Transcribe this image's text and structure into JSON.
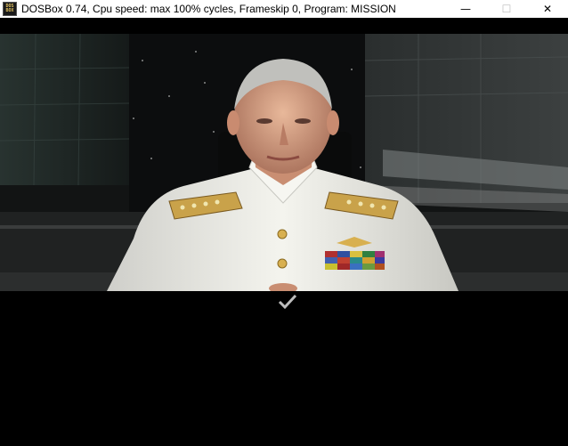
{
  "window": {
    "icon_label_top": "DOS",
    "icon_label_bottom": "BOX",
    "title": "DOSBox 0.74, Cpu speed: max 100% cycles, Frameskip  0, Program:  MISSION",
    "minimize_glyph": "—",
    "maximize_glyph": "☐",
    "close_glyph": "✕"
  },
  "game": {
    "scene": "admiral-briefing",
    "confirm_icon": "checkmark-icon"
  },
  "colors": {
    "uniform": "#f0efe8",
    "background": "#000000",
    "gold": "#c9a24a"
  }
}
